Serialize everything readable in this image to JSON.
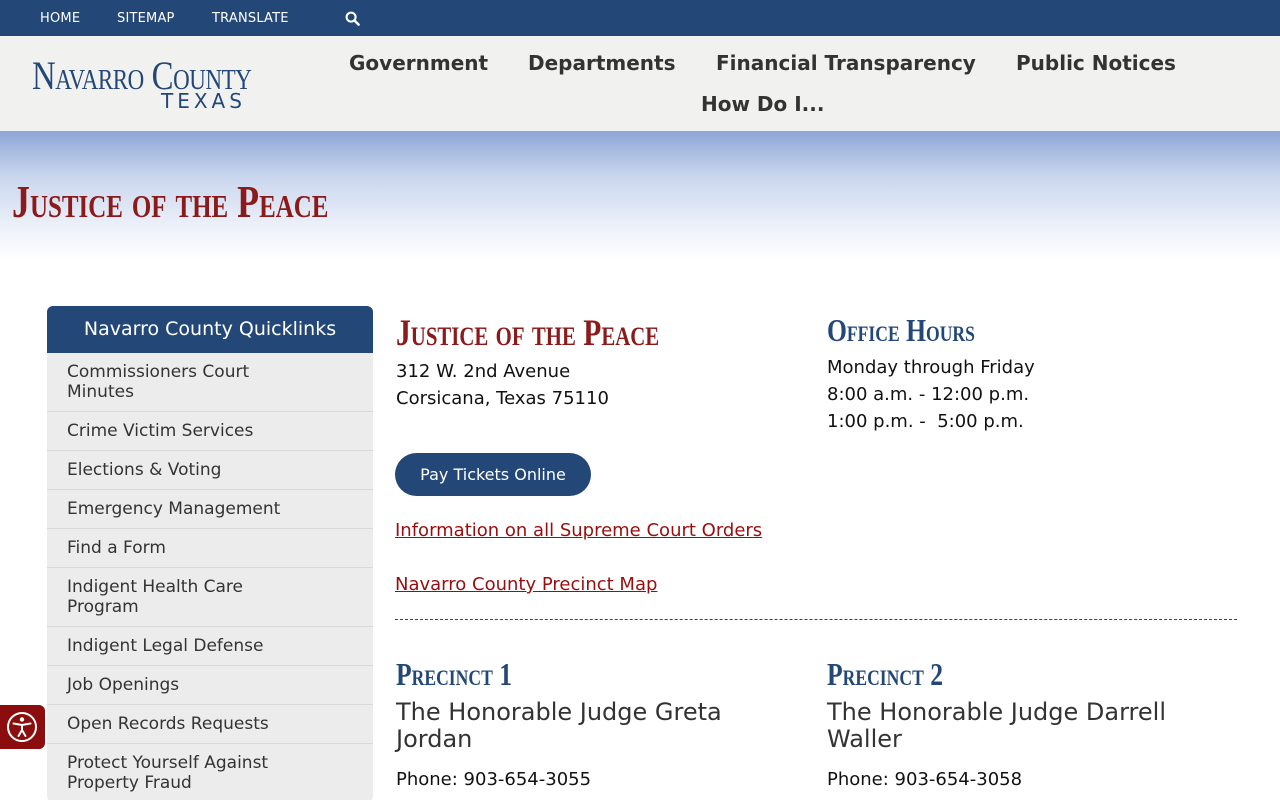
{
  "utility_nav": {
    "items": [
      "HOME",
      "SITEMAP",
      "TRANSLATE"
    ],
    "search_icon": "search-icon"
  },
  "logo": {
    "line1": "Navarro County",
    "line2": "TEXAS"
  },
  "main_nav": {
    "items": [
      "Government",
      "Departments",
      "Financial Transparency",
      "Public Notices",
      "How Do I..."
    ]
  },
  "page_title": "Justice of the Peace",
  "sidebar": {
    "heading": "Navarro County Quicklinks",
    "items": [
      "Commissioners Court Minutes",
      "Crime Victim Services",
      "Elections & Voting",
      "Emergency Management",
      "Find a Form",
      "Indigent Health Care Program",
      "Indigent Legal Defense",
      "Job Openings",
      "Open Records Requests",
      "Protect Yourself Against Property Fraud"
    ]
  },
  "office": {
    "title": "Justice of the Peace",
    "address_line1": "312 W. 2nd Avenue",
    "address_line2": "Corsicana, Texas 75110",
    "pay_button": "Pay Tickets Online",
    "link_orders": "Information on all Supreme Court Orders",
    "link_map": "Navarro County Precinct Map"
  },
  "hours": {
    "title": "Office Hours",
    "line1": "Monday through Friday",
    "line2": "8:00 a.m. - 12:00 p.m.",
    "line3": "1:00 p.m. -  5:00 p.m."
  },
  "precincts": [
    {
      "title": "Precinct 1",
      "judge": "The Honorable Judge Greta Jordan",
      "phone": "Phone: 903-654-3055"
    },
    {
      "title": "Precinct 2",
      "judge": "The Honorable Judge Darrell Waller",
      "phone": "Phone: 903-654-3058"
    }
  ],
  "colors": {
    "navy": "#234877",
    "red": "#8b1a1a",
    "link_red": "#9b0d0d",
    "header_bg": "#f1f1f0"
  },
  "accessibility_icon": "accessibility-icon"
}
